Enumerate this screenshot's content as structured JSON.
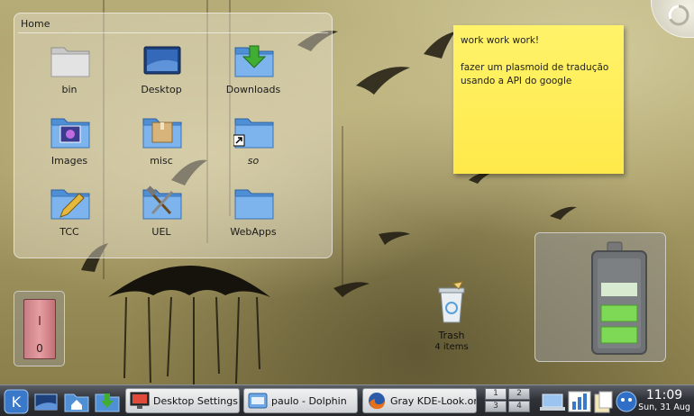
{
  "folderview": {
    "title": "Home",
    "items": [
      {
        "label": "bin",
        "icon": "folder-grey-icon"
      },
      {
        "label": "Desktop",
        "icon": "desktop-folder-icon"
      },
      {
        "label": "Downloads",
        "icon": "downloads-folder-icon"
      },
      {
        "label": "Images",
        "icon": "images-folder-icon"
      },
      {
        "label": "misc",
        "icon": "package-folder-icon"
      },
      {
        "label": "so",
        "icon": "folder-link-icon"
      },
      {
        "label": "TCC",
        "icon": "folder-pencil-icon"
      },
      {
        "label": "UEL",
        "icon": "folder-tools-icon"
      },
      {
        "label": "WebApps",
        "icon": "folder-icon"
      }
    ]
  },
  "note": {
    "line1": "work work work!",
    "line2": "fazer um plasmoid de tradução usando a API do google"
  },
  "battery": {
    "charge_fraction": 0.5
  },
  "switch": {
    "on_label": "I",
    "off_label": "0"
  },
  "trash": {
    "label": "Trash",
    "count": "4 items"
  },
  "taskbar": {
    "tasks": [
      {
        "label": "Desktop Settings"
      },
      {
        "label": "paulo - Dolphin"
      },
      {
        "label": "Gray KDE-Look.org"
      }
    ],
    "pager": [
      "1",
      "2",
      "3",
      "4"
    ],
    "clock": {
      "time": "11:09",
      "date": "Sun, 31 Aug"
    }
  },
  "colors": {
    "note": "#ffe94a",
    "panel": "#2f3237",
    "battery_green": "#7ed957"
  }
}
